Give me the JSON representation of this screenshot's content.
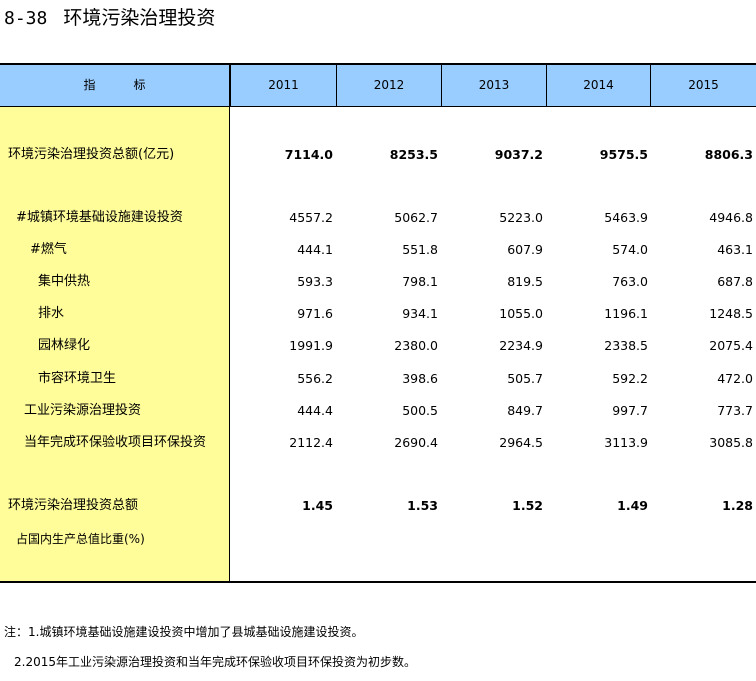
{
  "page": {
    "number": "8-38",
    "title": "环境污染治理投资"
  },
  "table": {
    "indicator_header": [
      "指",
      "标"
    ],
    "years": [
      "2011",
      "2012",
      "2013",
      "2014",
      "2015"
    ],
    "rows": [
      {
        "label": "环境污染治理投资总额(亿元)",
        "values": [
          "7114.0",
          "8253.5",
          "9037.2",
          "9575.5",
          "8806.3"
        ],
        "bold": true
      },
      {
        "label": "#城镇环境基础设施建设投资",
        "values": [
          "4557.2",
          "5062.7",
          "5223.0",
          "5463.9",
          "4946.8"
        ],
        "bold": false
      },
      {
        "label": "#燃气",
        "values": [
          "444.1",
          "551.8",
          "607.9",
          "574.0",
          "463.1"
        ],
        "bold": false
      },
      {
        "label": "集中供热",
        "values": [
          "593.3",
          "798.1",
          "819.5",
          "763.0",
          "687.8"
        ],
        "bold": false
      },
      {
        "label": "排水",
        "values": [
          "971.6",
          "934.1",
          "1055.0",
          "1196.1",
          "1248.5"
        ],
        "bold": false
      },
      {
        "label": "园林绿化",
        "values": [
          "1991.9",
          "2380.0",
          "2234.9",
          "2338.5",
          "2075.4"
        ],
        "bold": false
      },
      {
        "label": "市容环境卫生",
        "values": [
          "556.2",
          "398.6",
          "505.7",
          "592.2",
          "472.0"
        ],
        "bold": false
      },
      {
        "label": "工业污染源治理投资",
        "values": [
          "444.4",
          "500.5",
          "849.7",
          "997.7",
          "773.7"
        ],
        "bold": false
      },
      {
        "label": "当年完成环保验收项目环保投资",
        "values": [
          "2112.4",
          "2690.4",
          "2964.5",
          "3113.9",
          "3085.8"
        ],
        "bold": false
      },
      {
        "label": "环境污染治理投资总额",
        "values": [
          "1.45",
          "1.53",
          "1.52",
          "1.49",
          "1.28"
        ],
        "bold": true
      }
    ],
    "last_row_label_line2": "占国内生产总值比重(%)"
  },
  "notes": [
    "注：1.城镇环境基础设施建设投资中增加了县城基础设施建设投资。",
    "2.2015年工业污染源治理投资和当年完成环保验收项目环保投资为初步数。"
  ]
}
